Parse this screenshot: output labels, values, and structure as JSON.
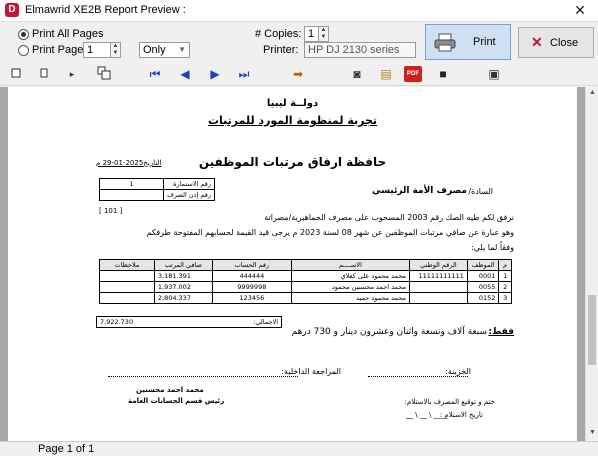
{
  "window": {
    "title": "Elmawrid XE2B Report Preview :",
    "app_icon_letter": "D",
    "close_glyph": "✕"
  },
  "options": {
    "print_all_label": "Print All Pages",
    "print_page_label": "Print Page",
    "print_page_value": "1",
    "only_value": "Only",
    "copies_label": "# Copies:",
    "copies_value": "1",
    "printer_label": "Printer:",
    "printer_value": "HP DJ 2130 series",
    "print_button": "Print",
    "close_button": "Close"
  },
  "status": {
    "page_info": "Page 1 of 1"
  },
  "report": {
    "line1": "دولــة ليبيا",
    "line2": "تجربة لمنظومة المورد للمرتبات",
    "doc_title": "حافظة ارفاق مرتبات الموظفين",
    "date_text": "التاريخ2025-01-29 م",
    "bank_label": "السادة/",
    "bank_name": "مصرف الأمة الرئيسي",
    "batch_label": "رقم الاستمارة",
    "batch_value": "1",
    "auth_label": "رقم إذن الصرف",
    "auth_value": "",
    "bracket_value": "[ 101 ]",
    "body_line1": "نرفق لكم طيه الصك رقم  2003  المسحوب على مصرف الجماهيرية/مصراتة",
    "body_line2": "وهو عبارة عن صافي مرتبات الموظفين عن شهر 08 لسنة 2023 م يرجى قيد القيمة لحسابهم المفتوحة طرفكم",
    "body_line3": "وفقاً لما يلي:",
    "columns": [
      "م",
      "الموظف",
      "الرقم الوطني",
      "الاســــم",
      "رقم الحساب",
      "صافي المرتب",
      "ملاحظات"
    ],
    "rows": [
      {
        "n": "1",
        "emp": "0001",
        "nid": "11111111111",
        "name": "محمد محمود على كعلاي",
        "acct": "444444",
        "net": "3,181.391",
        "notes": ""
      },
      {
        "n": "2",
        "emp": "0055",
        "nid": "",
        "name": "محمد احمد محسنين محمود",
        "acct": "9999998",
        "net": "1,937.002",
        "notes": ""
      },
      {
        "n": "3",
        "emp": "0152",
        "nid": "",
        "name": "محمد محمود حميد",
        "acct": "123456",
        "net": "2,804.337",
        "notes": ""
      }
    ],
    "total_label": "الاجمالي:",
    "total_value": "7,922.730",
    "words_label": "فقط:",
    "words_value": "سبعة آلاف وتسعة واثنان وعشرون دينار و 730 درهم",
    "treasurer_label": "الخزينة:",
    "internal_review_label": "المراجعة الداخلية:",
    "signer_name": "محمد احمد محسنين",
    "signer_title": "رئيس قسم الحسابات العامة",
    "stamp_label": "ختم و توقيع المصرف بالاستلام:",
    "receipt_date_label": "تاريخ الاستلام :",
    "receipt_date_value": "__ \\ __ \\ ____"
  }
}
